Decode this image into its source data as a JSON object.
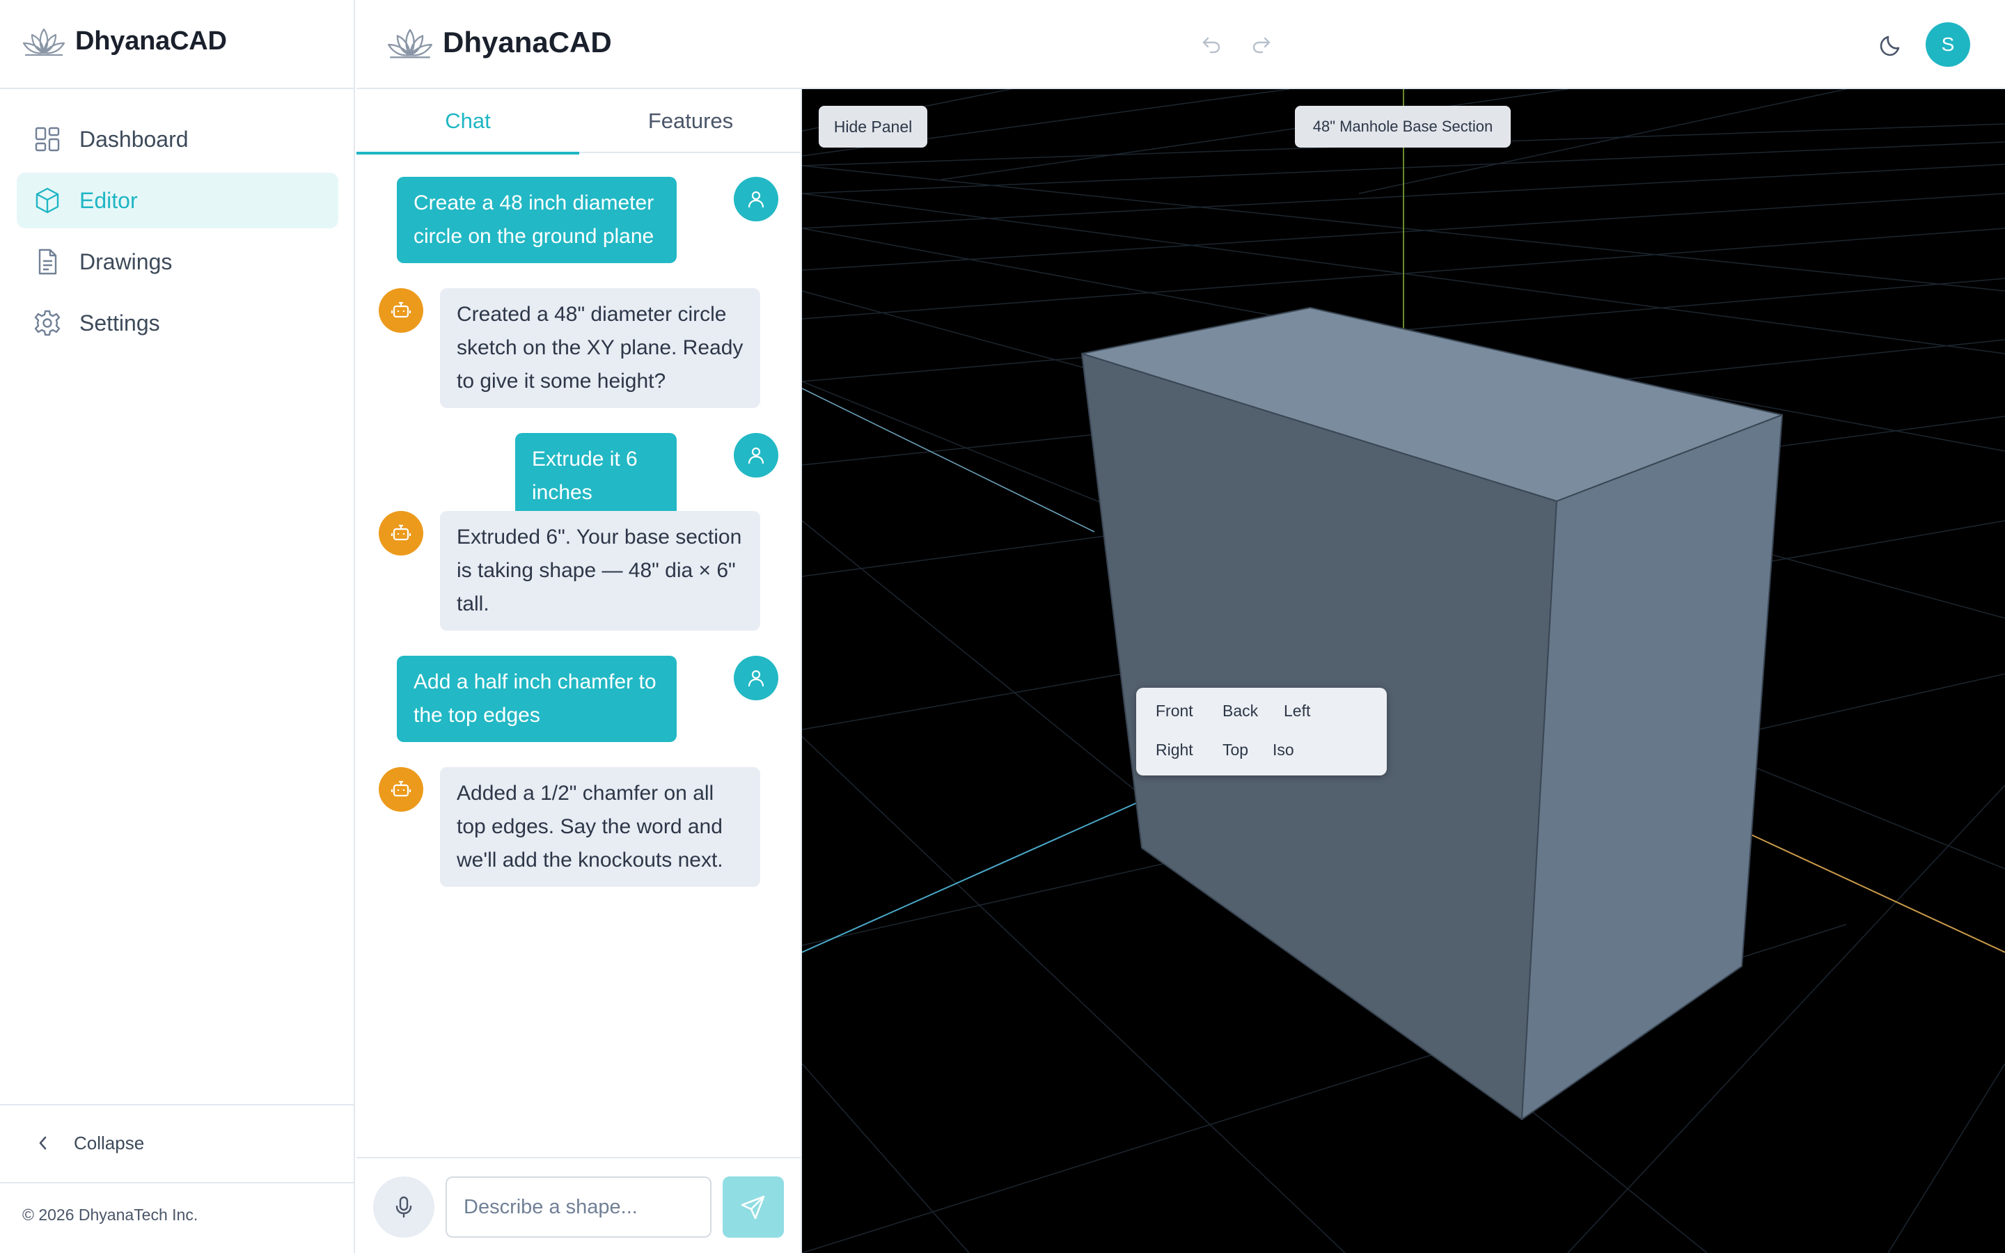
{
  "app": {
    "name": "DhyanaCAD"
  },
  "sidebar": {
    "items": [
      {
        "label": "Dashboard",
        "icon": "dashboard-grid-icon",
        "active": false
      },
      {
        "label": "Editor",
        "icon": "cube-icon",
        "active": true
      },
      {
        "label": "Drawings",
        "icon": "document-icon",
        "active": false
      },
      {
        "label": "Settings",
        "icon": "gear-icon",
        "active": false
      }
    ],
    "collapse_label": "Collapse",
    "copyright": "© 2026 DhyanaTech Inc."
  },
  "header": {
    "avatar_initial": "S",
    "icons": [
      "undo-icon",
      "redo-icon",
      "moon-icon"
    ]
  },
  "chat_panel": {
    "tabs": [
      {
        "label": "Chat",
        "active": true
      },
      {
        "label": "Features",
        "active": false
      }
    ],
    "messages": [
      {
        "role": "user",
        "text": "Create a 48 inch diameter circle on the ground plane"
      },
      {
        "role": "assistant",
        "text": "Created a 48\" diameter circle sketch on the XY plane. Ready to give it some height?"
      },
      {
        "role": "user",
        "text": "Extrude it 6 inches"
      },
      {
        "role": "assistant",
        "text": "Extruded 6\". Your base section is taking shape — 48\" dia × 6\" tall."
      },
      {
        "role": "user",
        "text": "Add a half inch chamfer to the top edges"
      },
      {
        "role": "assistant",
        "text": "Added a 1/2\" chamfer on all top edges. Say the word and we'll add the knockouts next."
      }
    ],
    "input": {
      "value": "",
      "placeholder": "Describe a shape..."
    }
  },
  "viewport": {
    "hide_panel_label": "Hide Panel",
    "model_name": "48\" Manhole Base Section",
    "view_buttons": [
      "Front",
      "Back",
      "Left",
      "Right",
      "Top",
      "Iso"
    ]
  },
  "colors": {
    "accent": "#1fb6c4",
    "bot_avatar": "#ec9a1c",
    "viewport_bg": "#000000",
    "model": "#6b7f91"
  }
}
